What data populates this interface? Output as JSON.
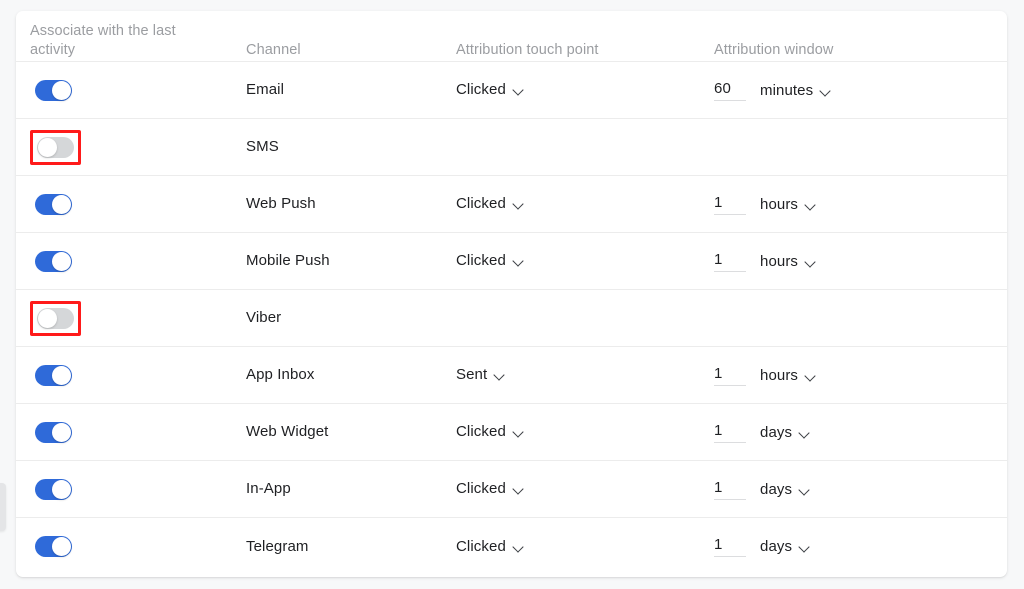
{
  "table": {
    "columns": {
      "toggle": "Associate with the last activity",
      "channel": "Channel",
      "touch_point": "Attribution touch point",
      "window": "Attribution window"
    },
    "rows": [
      {
        "channel": "Email",
        "enabled": true,
        "flagged": false,
        "touch_point": "Clicked",
        "window_value": "60",
        "window_unit": "minutes"
      },
      {
        "channel": "SMS",
        "enabled": false,
        "flagged": true,
        "touch_point": "",
        "window_value": "",
        "window_unit": ""
      },
      {
        "channel": "Web Push",
        "enabled": true,
        "flagged": false,
        "touch_point": "Clicked",
        "window_value": "1",
        "window_unit": "hours"
      },
      {
        "channel": "Mobile Push",
        "enabled": true,
        "flagged": false,
        "touch_point": "Clicked",
        "window_value": "1",
        "window_unit": "hours"
      },
      {
        "channel": "Viber",
        "enabled": false,
        "flagged": true,
        "touch_point": "",
        "window_value": "",
        "window_unit": ""
      },
      {
        "channel": "App Inbox",
        "enabled": true,
        "flagged": false,
        "touch_point": "Sent",
        "window_value": "1",
        "window_unit": "hours"
      },
      {
        "channel": "Web Widget",
        "enabled": true,
        "flagged": false,
        "touch_point": "Clicked",
        "window_value": "1",
        "window_unit": "days"
      },
      {
        "channel": "In-App",
        "enabled": true,
        "flagged": false,
        "touch_point": "Clicked",
        "window_value": "1",
        "window_unit": "days"
      },
      {
        "channel": "Telegram",
        "enabled": true,
        "flagged": false,
        "touch_point": "Clicked",
        "window_value": "1",
        "window_unit": "days"
      }
    ]
  },
  "colors": {
    "toggle_on": "#2f6ad9",
    "toggle_off": "#d5d7d9",
    "highlight": "#ff1a1a",
    "page_background": "#f7f8f9",
    "card_background": "#ffffff",
    "header_text": "#9b9da1",
    "body_text": "#1f2023"
  }
}
